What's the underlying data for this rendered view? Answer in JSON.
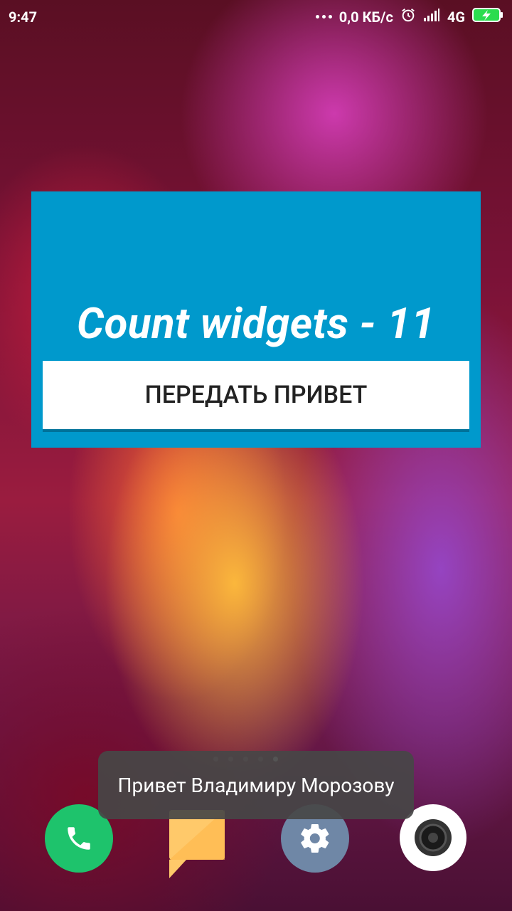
{
  "status_bar": {
    "time": "9:47",
    "network_speed": "0,0 КБ/с",
    "network_type": "4G",
    "icons": [
      "more-dots-icon",
      "alarm-icon",
      "signal-icon",
      "battery-charging-icon"
    ]
  },
  "widget": {
    "count_text": "Count widgets - 11",
    "button_label": "ПЕРЕДАТЬ ПРИВЕТ",
    "background_color": "#0099cc"
  },
  "toast": {
    "message": "Привет Владимиру Морозову"
  },
  "page_indicator": {
    "count": 5,
    "active_index": 4
  },
  "dock": {
    "apps": [
      "phone-icon",
      "messages-icon",
      "settings-icon",
      "camera-icon"
    ]
  }
}
